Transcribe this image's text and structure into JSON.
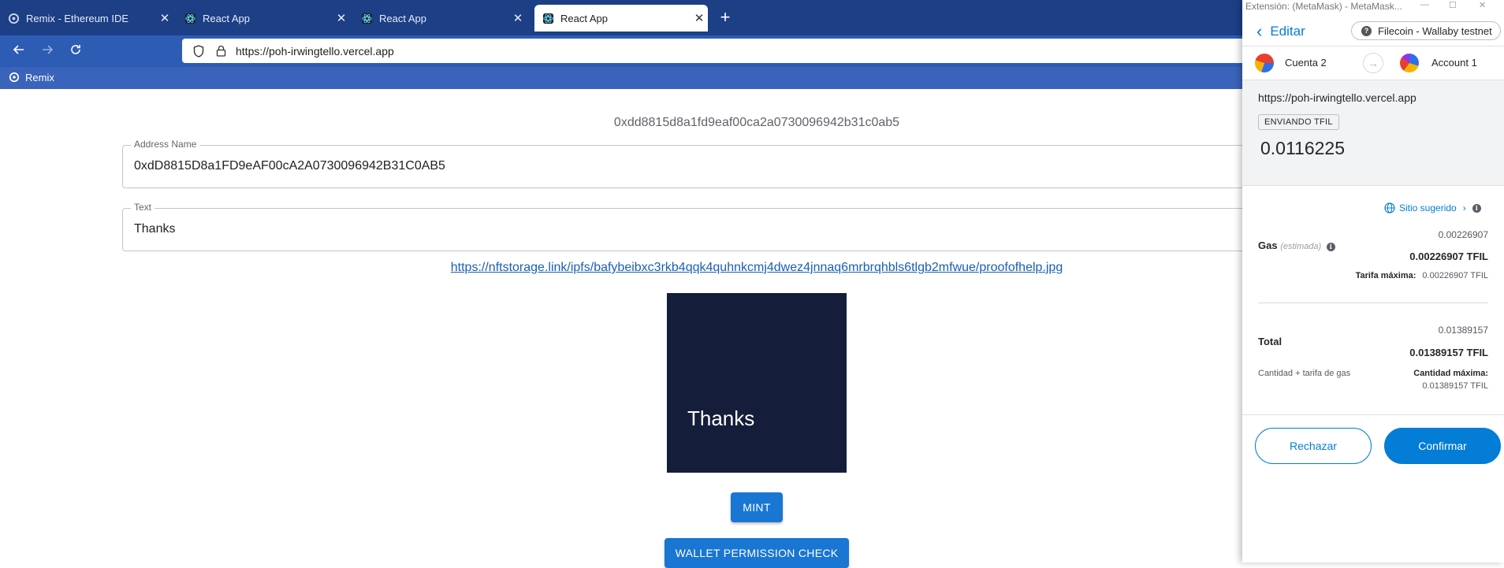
{
  "browser": {
    "tabs": [
      {
        "title": "Remix - Ethereum IDE",
        "icon": "remix-icon",
        "active": false
      },
      {
        "title": "React App",
        "icon": "react-icon",
        "active": false
      },
      {
        "title": "React App",
        "icon": "react-icon",
        "active": false
      },
      {
        "title": "React App",
        "icon": "react-icon",
        "active": true
      }
    ],
    "close_glyph": "✕",
    "new_tab_glyph": "+",
    "url": "https://poh-irwingtello.vercel.app",
    "bookmark": "Remix"
  },
  "page": {
    "address_display": "0xdd8815d8a1fd9eaf00ca2a0730096942b31c0ab5",
    "address_field": {
      "label": "Address Name",
      "value": "0xdD8815D8a1FD9eAF00cA2A0730096942B31C0AB5"
    },
    "text_field": {
      "label": "Text",
      "value": "Thanks"
    },
    "ipfs_link": "https://nftstorage.link/ipfs/bafybeibxc3rkb4qqk4quhnkcmj4dwez4jnnaq6mrbrqhbls6tlgb2mfwue/proofofhelp.jpg",
    "nft_text": "Thanks",
    "mint_label": "MINT",
    "wallet_check_label": "WALLET PERMISSION CHECK"
  },
  "metamask": {
    "window_title": "Extensión: (MetaMask) - MetaMask...",
    "edit_label": "Editar",
    "network": "Filecoin - Wallaby testnet",
    "from_account": "Cuenta 2",
    "to_account": "Account 1",
    "origin": "https://poh-irwingtello.vercel.app",
    "action_badge": "ENVIANDO TFIL",
    "amount": "0.0116225",
    "suggested_site": "Sitio sugerido",
    "gas_label": "Gas",
    "gas_estimated": "(estimada)",
    "gas_value": "0.00226907",
    "gas_value_bold": "0.00226907 TFIL",
    "max_fee_label": "Tarifa máxima:",
    "max_fee_value": "0.00226907 TFIL",
    "total_label": "Total",
    "total_value": "0.01389157",
    "total_value_bold": "0.01389157 TFIL",
    "amount_plus_gas_label": "Cantidad + tarifa de gas",
    "max_amount_label": "Cantidad máxima:",
    "max_amount_value": "0.01389157 TFIL",
    "reject_label": "Rechazar",
    "confirm_label": "Confirmar",
    "accent_color": "#037dd6"
  }
}
